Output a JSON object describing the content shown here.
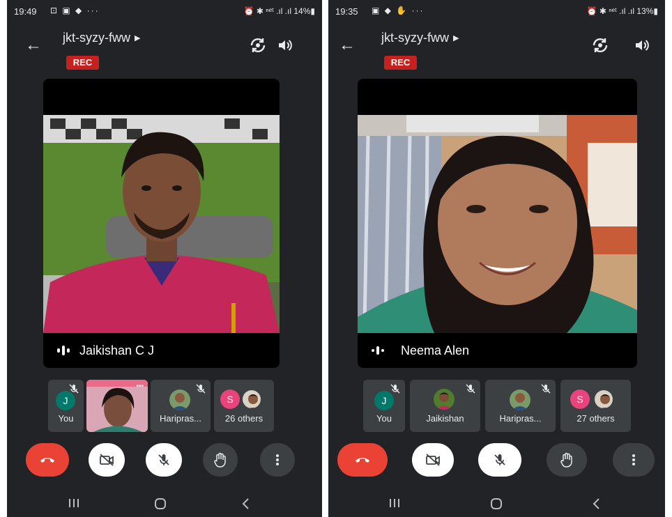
{
  "left": {
    "status": {
      "time": "19:49",
      "icons": "⊡ ▣ ◆ ···",
      "right": "⏰ ✱ ⁿᵉᵗ .ıl .ıl 14%▮"
    },
    "meeting_name": "jkt-syzy-fww",
    "rec_label": "REC",
    "speaker_name": "Jaikishan C J",
    "tiles": {
      "you_initial": "J",
      "you_label": "You",
      "hari_label": "Haripras...",
      "others_initial": "S",
      "others_label": "26 others"
    }
  },
  "right": {
    "status": {
      "time": "19:35",
      "icons": "▣ ◆ ✋ ···",
      "right": "⏰ ✱ ⁿᵉᵗ .ıl .ıl 13%▮"
    },
    "meeting_name": "jkt-syzy-fww",
    "rec_label": "REC",
    "speaker_name": "Neema Alen",
    "tiles": {
      "you_initial": "J",
      "you_label": "You",
      "jaikishan_label": "Jaikishan",
      "hari_label": "Haripras...",
      "others_initial": "S",
      "others_label": "27 others"
    }
  },
  "colors": {
    "background": "#222326",
    "tile": "#3c4043",
    "rec_red": "#c5221f",
    "end_call_red": "#ea4335",
    "avatar_teal": "#00796b",
    "avatar_pink": "#e8437a",
    "dark_button": "#3c4043"
  },
  "icons": [
    "arrow-back-icon",
    "switch-camera-icon",
    "speaker-icon",
    "speaking-indicator-icon",
    "mic-off-icon",
    "end-call-icon",
    "camera-off-icon",
    "raise-hand-icon",
    "more-options-icon",
    "recent-apps-icon",
    "home-icon",
    "back-nav-icon"
  ]
}
